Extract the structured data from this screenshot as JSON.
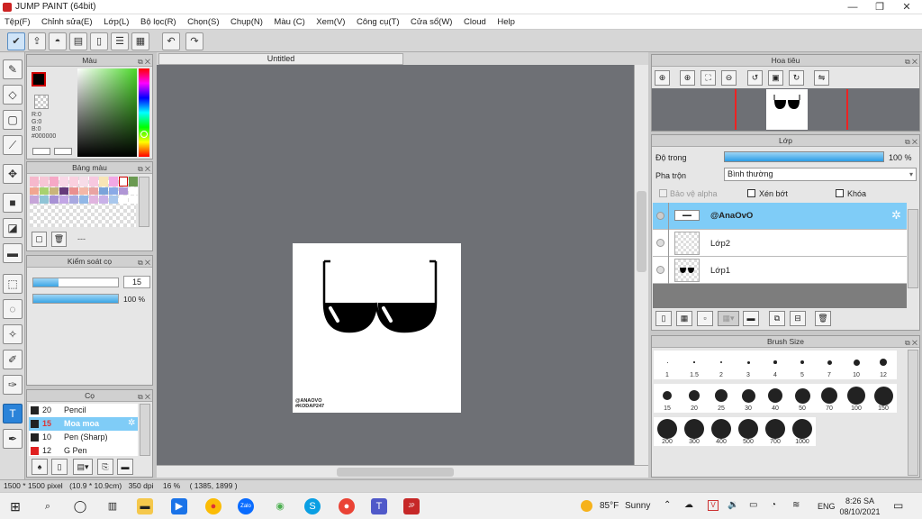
{
  "window": {
    "title": "JUMP PAINT (64bit)",
    "minimize": "—",
    "maximize": "❐",
    "close": "✕"
  },
  "menu": [
    "Tệp(F)",
    "Chỉnh sửa(E)",
    "Lớp(L)",
    "Bộ lọc(R)",
    "Chọn(S)",
    "Chụp(N)",
    "Màu (C)",
    "Xem(V)",
    "Công cụ(T)",
    "Cửa sổ(W)",
    "Cloud",
    "Help"
  ],
  "color_panel": {
    "title": "Màu",
    "r": "R:0",
    "g": "G:0",
    "b": "B:0",
    "hex": "#000000"
  },
  "palette_panel": {
    "title": "Bảng màu",
    "dashes": "---"
  },
  "brush_control": {
    "title": "Kiểm soát cọ",
    "size": "15",
    "opacity": "100 %"
  },
  "brush_panel": {
    "title": "Cọ",
    "items": [
      {
        "size": "20",
        "name": "Pencil",
        "color": "#222222"
      },
      {
        "size": "15",
        "name": "Moa moa",
        "color": "#222222"
      },
      {
        "size": "10",
        "name": "Pen (Sharp)",
        "color": "#222222"
      },
      {
        "size": "12",
        "name": "G Pen",
        "color": "#e02020"
      }
    ]
  },
  "canvas": {
    "tab": "Untitled",
    "watermark_line1": "@ANAOVO",
    "watermark_line2": "#KODAP247"
  },
  "navigator": {
    "title": "Hoa tiêu"
  },
  "layers": {
    "title": "Lớp",
    "opacity_label": "Độ trong",
    "opacity_value": "100 %",
    "blend_label": "Pha trộn",
    "blend_value": "Bình thường",
    "protect_alpha": "Bảo vệ alpha",
    "clipping": "Xén bớt",
    "lock": "Khóa",
    "rows": [
      {
        "name": "@AnaOvO",
        "selected": true
      },
      {
        "name": "Lớp2",
        "selected": false
      },
      {
        "name": "Lớp1",
        "selected": false
      }
    ]
  },
  "brush_size": {
    "title": "Brush Size",
    "sizes": [
      "1",
      "1.5",
      "2",
      "3",
      "4",
      "5",
      "7",
      "10",
      "12",
      "15",
      "20",
      "25",
      "30",
      "40",
      "50",
      "70",
      "100",
      "150",
      "200",
      "300",
      "400",
      "500",
      "700",
      "1000"
    ]
  },
  "status": {
    "dims": "1500 * 1500 pixel",
    "cm": "(10.9 * 10.9cm)",
    "dpi": "350 dpi",
    "zoom": "16 %",
    "coords": "( 1385, 1899 )"
  },
  "taskbar": {
    "weather_temp": "85°F",
    "weather_text": "Sunny",
    "lang": "ENG",
    "time": "8:26 SA",
    "date": "08/10/2021"
  }
}
